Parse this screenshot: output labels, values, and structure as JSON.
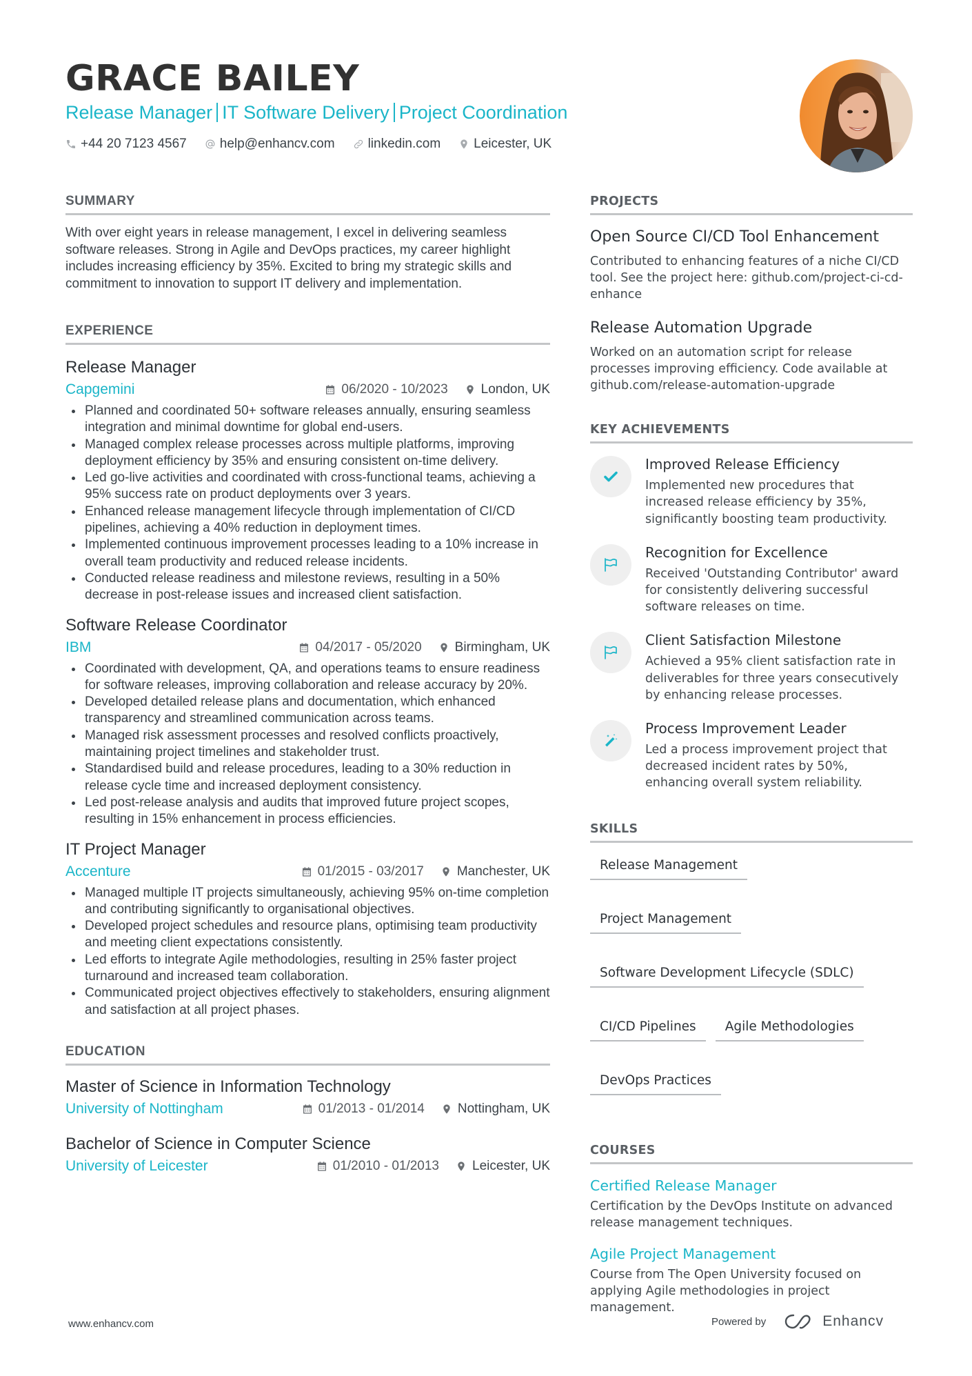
{
  "header": {
    "name": "GRACE BAILEY",
    "headline_parts": [
      "Release Manager",
      "IT Software Delivery",
      "Project Coordination"
    ],
    "contacts": [
      {
        "icon": "phone-icon",
        "text": "+44 20 7123 4567"
      },
      {
        "icon": "at-icon",
        "text": "help@enhancv.com"
      },
      {
        "icon": "link-icon",
        "text": "linkedin.com"
      },
      {
        "icon": "location-icon",
        "text": "Leicester, UK"
      }
    ],
    "photo_alt": "Profile photo"
  },
  "colors": {
    "accent": "#1ab5c8",
    "text": "#3b4248",
    "heading": "#2d3237",
    "divider": "#c3c5c7",
    "icon_circle": "#efefef"
  },
  "summary": {
    "title": "SUMMARY",
    "text": "With over eight years in release management, I excel in delivering seamless software releases. Strong in Agile and DevOps practices, my career highlight includes increasing efficiency by 35%. Excited to bring my strategic skills and commitment to innovation to support IT delivery and implementation."
  },
  "experience": {
    "title": "EXPERIENCE",
    "jobs": [
      {
        "title": "Release Manager",
        "company": "Capgemini",
        "dates": "06/2020 - 10/2023",
        "location": "London, UK",
        "bullets": [
          "Planned and coordinated 50+ software releases annually, ensuring seamless integration and minimal downtime for global end-users.",
          "Managed complex release processes across multiple platforms, improving deployment efficiency by 35% and ensuring consistent on-time delivery.",
          "Led go-live activities and coordinated with cross-functional teams, achieving a 95% success rate on product deployments over 3 years.",
          "Enhanced release management lifecycle through implementation of CI/CD pipelines, achieving a 40% reduction in deployment times.",
          "Implemented continuous improvement processes leading to a 10% increase in overall team productivity and reduced release incidents.",
          "Conducted release readiness and milestone reviews, resulting in a 50% decrease in post-release issues and increased client satisfaction."
        ]
      },
      {
        "title": "Software Release Coordinator",
        "company": "IBM",
        "dates": "04/2017 - 05/2020",
        "location": "Birmingham, UK",
        "bullets": [
          "Coordinated with development, QA, and operations teams to ensure readiness for software releases, improving collaboration and release accuracy by 20%.",
          "Developed detailed release plans and documentation, which enhanced transparency and streamlined communication across teams.",
          "Managed risk assessment processes and resolved conflicts proactively, maintaining project timelines and stakeholder trust.",
          "Standardised build and release procedures, leading to a 30% reduction in release cycle time and increased deployment consistency.",
          "Led post-release analysis and audits that improved future project scopes, resulting in 15% enhancement in process efficiencies."
        ]
      },
      {
        "title": "IT Project Manager",
        "company": "Accenture",
        "dates": "01/2015 - 03/2017",
        "location": "Manchester, UK",
        "bullets": [
          "Managed multiple IT projects simultaneously, achieving 95% on-time completion and contributing significantly to organisational objectives.",
          "Developed project schedules and resource plans, optimising team productivity and meeting client expectations consistently.",
          "Led efforts to integrate Agile methodologies, resulting in 25% faster project turnaround and increased team collaboration.",
          "Communicated project objectives effectively to stakeholders, ensuring alignment and satisfaction at all project phases."
        ]
      }
    ]
  },
  "education": {
    "title": "EDUCATION",
    "items": [
      {
        "degree": "Master of Science in Information Technology",
        "school": "University of Nottingham",
        "dates": "01/2013 - 01/2014",
        "location": "Nottingham, UK"
      },
      {
        "degree": "Bachelor of Science in Computer Science",
        "school": "University of Leicester",
        "dates": "01/2010 - 01/2013",
        "location": "Leicester, UK"
      }
    ]
  },
  "projects": {
    "title": "PROJECTS",
    "items": [
      {
        "title": "Open Source CI/CD Tool Enhancement",
        "description": "Contributed to enhancing features of a niche CI/CD tool. See the project here: github.com/project-ci-cd-enhance"
      },
      {
        "title": "Release Automation Upgrade",
        "description": "Worked on an automation script for release processes improving efficiency. Code available at github.com/release-automation-upgrade"
      }
    ]
  },
  "achievements": {
    "title": "KEY ACHIEVEMENTS",
    "items": [
      {
        "icon": "checkmark-icon",
        "title": "Improved Release Efficiency",
        "description": "Implemented new procedures that increased release efficiency by 35%, significantly boosting team productivity."
      },
      {
        "icon": "flag-icon",
        "title": "Recognition for Excellence",
        "description": "Received 'Outstanding Contributor' award for consistently delivering successful software releases on time."
      },
      {
        "icon": "flag-icon",
        "title": "Client Satisfaction Milestone",
        "description": "Achieved a 95% client satisfaction rate in deliverables for three years consecutively by enhancing release processes."
      },
      {
        "icon": "magic-wand-icon",
        "title": "Process Improvement Leader",
        "description": "Led a process improvement project that decreased incident rates by 50%, enhancing overall system reliability."
      }
    ]
  },
  "skills": {
    "title": "SKILLS",
    "items": [
      "Release Management",
      "Project Management",
      "Software Development Lifecycle (SDLC)",
      "CI/CD Pipelines",
      "Agile Methodologies",
      "DevOps Practices"
    ]
  },
  "courses": {
    "title": "COURSES",
    "items": [
      {
        "title": "Certified Release Manager",
        "description": "Certification by the DevOps Institute on advanced release management techniques."
      },
      {
        "title": "Agile Project Management",
        "description": "Course from The Open University focused on applying Agile methodologies in project management."
      }
    ]
  },
  "footer": {
    "website": "www.enhancv.com",
    "powered_by": "Powered by",
    "brand": "Enhancv"
  }
}
